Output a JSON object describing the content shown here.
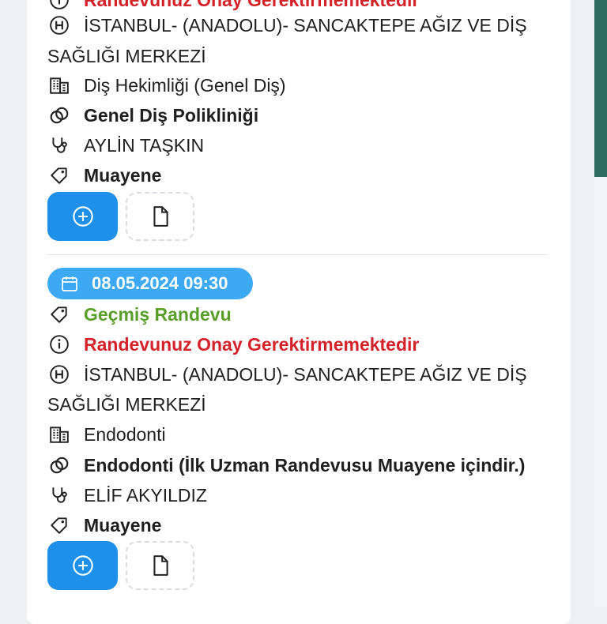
{
  "appointments": [
    {
      "status_note": "Randevunuz Onay Gerektirmemektedir",
      "hospital_line1": "İSTANBUL- (ANADOLU)- SANCAKTEPE AĞIZ VE DİŞ",
      "hospital_line2": "SAĞLIĞI MERKEZİ",
      "clinic": "Diş Hekimliği (Genel Diş)",
      "section": "Genel Diş Polikliniği",
      "doctor": "AYLİN TAŞKIN",
      "type": "Muayene"
    },
    {
      "date": "08.05.2024 09:30",
      "tag": "Geçmiş Randevu",
      "status_note": "Randevunuz Onay Gerektirmemektedir",
      "hospital_line1": "İSTANBUL- (ANADOLU)- SANCAKTEPE AĞIZ VE DİŞ",
      "hospital_line2": "SAĞLIĞI MERKEZİ",
      "clinic": "Endodonti",
      "section": "Endodonti (İlk Uzman Randevusu Muayene içindir.)",
      "doctor": "ELİF AKYILDIZ",
      "type": "Muayene"
    }
  ],
  "colors": {
    "primary": "#1e90ea",
    "date_pill": "#3da9f5",
    "past_tag": "#5a9e2a",
    "status_red": "#d32229"
  },
  "icons": [
    "hospital-icon",
    "building-icon",
    "section-icon",
    "stethoscope-icon",
    "tag-icon",
    "info-icon",
    "calendar-icon",
    "add-circle-icon",
    "document-icon"
  ]
}
